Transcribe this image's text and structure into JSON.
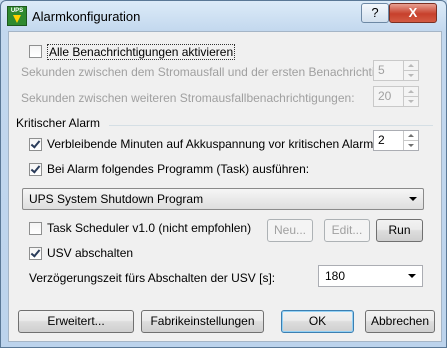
{
  "window": {
    "title": "Alarmkonfiguration",
    "app_icon_text": "UPS",
    "help_label": "?",
    "close_label": "X"
  },
  "notifications": {
    "enable_all_label": "Alle Benachrichtigungen aktivieren",
    "enable_all_checked": false,
    "first_delay_label": "Sekunden zwischen dem Stromausfall und der ersten Benachrichtigung:",
    "first_delay_value": "5",
    "repeat_delay_label": "Sekunden zwischen weiteren Stromausfallbenachrichtigungen:",
    "repeat_delay_value": "20"
  },
  "critical": {
    "group_label": "Kritischer Alarm",
    "minutes_label": "Verbleibende Minuten auf Akkuspannung vor kritischen Alarm:",
    "minutes_checked": true,
    "minutes_value": "2",
    "run_program_label": "Bei Alarm folgendes Programm (Task) ausführen:",
    "run_program_checked": true,
    "program_selected": "UPS System Shutdown Program",
    "task_scheduler_label": "Task Scheduler v1.0 (nicht empfohlen)",
    "task_scheduler_checked": false,
    "new_button": "Neu...",
    "edit_button": "Edit...",
    "run_button": "Run",
    "shutdown_ups_label": "USV abschalten",
    "shutdown_ups_checked": true,
    "shutdown_delay_label": "Verzögerungszeit fürs Abschalten der USV [s]:",
    "shutdown_delay_value": "180"
  },
  "footer": {
    "advanced_button": "Erweitert...",
    "defaults_button": "Fabrikeinstellungen",
    "ok_button": "OK",
    "cancel_button": "Abbrechen"
  },
  "colors": {
    "title_bar": "#c8dcf0",
    "close_button": "#c7402c",
    "client_background": "#f0f0f0",
    "default_button_border": "#3c7fb1"
  }
}
